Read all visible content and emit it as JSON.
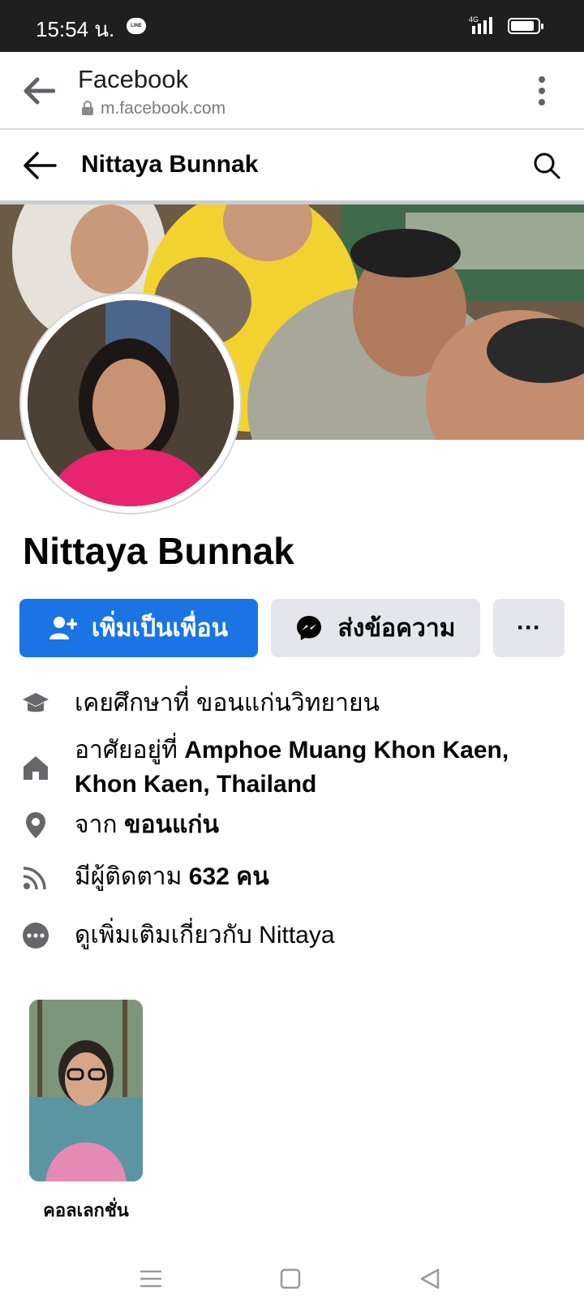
{
  "status_bar": {
    "time": "15:54 น.",
    "line_badge": "LINE",
    "network": "4G"
  },
  "browser": {
    "title": "Facebook",
    "url": "m.facebook.com"
  },
  "header": {
    "title": "Nittaya Bunnak"
  },
  "profile": {
    "name": "Nittaya Bunnak"
  },
  "actions": {
    "add_friend": "เพิ่มเป็นเพื่อน",
    "message": "ส่งข้อความ",
    "more": "···"
  },
  "details": {
    "education": {
      "prefix": "เคยศึกษาที่",
      "value": "ขอนแก่นวิทยายน"
    },
    "lives": {
      "prefix": "อาศัยอยู่ที่",
      "value": "Amphoe Muang Khon Kaen, Khon Kaen, Thailand"
    },
    "from": {
      "prefix": "จาก",
      "value": "ขอนแก่น"
    },
    "followers": {
      "prefix": "มีผู้ติดตาม",
      "value": "632 คน"
    },
    "see_more": "ดูเพิ่มเติมเกี่ยวกับ Nittaya"
  },
  "featured": {
    "label": "คอลเลกชั่น"
  },
  "colors": {
    "primary": "#1b74e4",
    "secondary_button": "#e4e6eb",
    "status_bar": "#1f1f1f"
  },
  "icons": [
    "back-arrow-icon",
    "lock-icon",
    "kebab-menu-icon",
    "search-icon",
    "add-friend-icon",
    "messenger-icon",
    "graduation-cap-icon",
    "home-icon",
    "location-pin-icon",
    "rss-icon",
    "more-dots-icon",
    "menu-lines-icon",
    "home-square-icon",
    "back-triangle-icon"
  ]
}
